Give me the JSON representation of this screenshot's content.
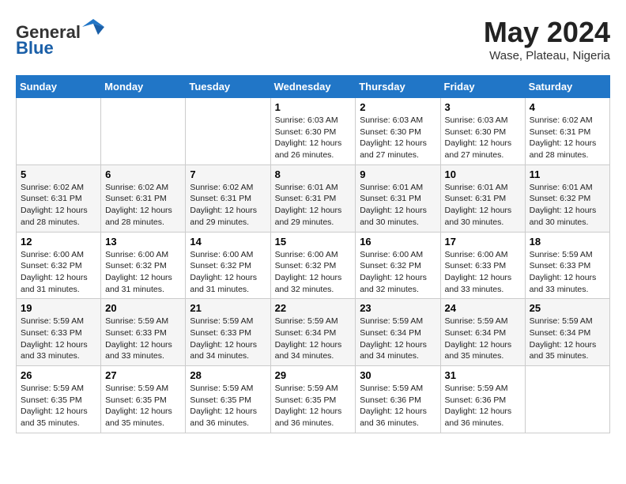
{
  "header": {
    "logo_general": "General",
    "logo_blue": "Blue",
    "month_year": "May 2024",
    "location": "Wase, Plateau, Nigeria"
  },
  "weekdays": [
    "Sunday",
    "Monday",
    "Tuesday",
    "Wednesday",
    "Thursday",
    "Friday",
    "Saturday"
  ],
  "weeks": [
    [
      {
        "day": "",
        "info": ""
      },
      {
        "day": "",
        "info": ""
      },
      {
        "day": "",
        "info": ""
      },
      {
        "day": "1",
        "info": "Sunrise: 6:03 AM\nSunset: 6:30 PM\nDaylight: 12 hours\nand 26 minutes."
      },
      {
        "day": "2",
        "info": "Sunrise: 6:03 AM\nSunset: 6:30 PM\nDaylight: 12 hours\nand 27 minutes."
      },
      {
        "day": "3",
        "info": "Sunrise: 6:03 AM\nSunset: 6:30 PM\nDaylight: 12 hours\nand 27 minutes."
      },
      {
        "day": "4",
        "info": "Sunrise: 6:02 AM\nSunset: 6:31 PM\nDaylight: 12 hours\nand 28 minutes."
      }
    ],
    [
      {
        "day": "5",
        "info": "Sunrise: 6:02 AM\nSunset: 6:31 PM\nDaylight: 12 hours\nand 28 minutes."
      },
      {
        "day": "6",
        "info": "Sunrise: 6:02 AM\nSunset: 6:31 PM\nDaylight: 12 hours\nand 28 minutes."
      },
      {
        "day": "7",
        "info": "Sunrise: 6:02 AM\nSunset: 6:31 PM\nDaylight: 12 hours\nand 29 minutes."
      },
      {
        "day": "8",
        "info": "Sunrise: 6:01 AM\nSunset: 6:31 PM\nDaylight: 12 hours\nand 29 minutes."
      },
      {
        "day": "9",
        "info": "Sunrise: 6:01 AM\nSunset: 6:31 PM\nDaylight: 12 hours\nand 30 minutes."
      },
      {
        "day": "10",
        "info": "Sunrise: 6:01 AM\nSunset: 6:31 PM\nDaylight: 12 hours\nand 30 minutes."
      },
      {
        "day": "11",
        "info": "Sunrise: 6:01 AM\nSunset: 6:32 PM\nDaylight: 12 hours\nand 30 minutes."
      }
    ],
    [
      {
        "day": "12",
        "info": "Sunrise: 6:00 AM\nSunset: 6:32 PM\nDaylight: 12 hours\nand 31 minutes."
      },
      {
        "day": "13",
        "info": "Sunrise: 6:00 AM\nSunset: 6:32 PM\nDaylight: 12 hours\nand 31 minutes."
      },
      {
        "day": "14",
        "info": "Sunrise: 6:00 AM\nSunset: 6:32 PM\nDaylight: 12 hours\nand 31 minutes."
      },
      {
        "day": "15",
        "info": "Sunrise: 6:00 AM\nSunset: 6:32 PM\nDaylight: 12 hours\nand 32 minutes."
      },
      {
        "day": "16",
        "info": "Sunrise: 6:00 AM\nSunset: 6:32 PM\nDaylight: 12 hours\nand 32 minutes."
      },
      {
        "day": "17",
        "info": "Sunrise: 6:00 AM\nSunset: 6:33 PM\nDaylight: 12 hours\nand 33 minutes."
      },
      {
        "day": "18",
        "info": "Sunrise: 5:59 AM\nSunset: 6:33 PM\nDaylight: 12 hours\nand 33 minutes."
      }
    ],
    [
      {
        "day": "19",
        "info": "Sunrise: 5:59 AM\nSunset: 6:33 PM\nDaylight: 12 hours\nand 33 minutes."
      },
      {
        "day": "20",
        "info": "Sunrise: 5:59 AM\nSunset: 6:33 PM\nDaylight: 12 hours\nand 33 minutes."
      },
      {
        "day": "21",
        "info": "Sunrise: 5:59 AM\nSunset: 6:33 PM\nDaylight: 12 hours\nand 34 minutes."
      },
      {
        "day": "22",
        "info": "Sunrise: 5:59 AM\nSunset: 6:34 PM\nDaylight: 12 hours\nand 34 minutes."
      },
      {
        "day": "23",
        "info": "Sunrise: 5:59 AM\nSunset: 6:34 PM\nDaylight: 12 hours\nand 34 minutes."
      },
      {
        "day": "24",
        "info": "Sunrise: 5:59 AM\nSunset: 6:34 PM\nDaylight: 12 hours\nand 35 minutes."
      },
      {
        "day": "25",
        "info": "Sunrise: 5:59 AM\nSunset: 6:34 PM\nDaylight: 12 hours\nand 35 minutes."
      }
    ],
    [
      {
        "day": "26",
        "info": "Sunrise: 5:59 AM\nSunset: 6:35 PM\nDaylight: 12 hours\nand 35 minutes."
      },
      {
        "day": "27",
        "info": "Sunrise: 5:59 AM\nSunset: 6:35 PM\nDaylight: 12 hours\nand 35 minutes."
      },
      {
        "day": "28",
        "info": "Sunrise: 5:59 AM\nSunset: 6:35 PM\nDaylight: 12 hours\nand 36 minutes."
      },
      {
        "day": "29",
        "info": "Sunrise: 5:59 AM\nSunset: 6:35 PM\nDaylight: 12 hours\nand 36 minutes."
      },
      {
        "day": "30",
        "info": "Sunrise: 5:59 AM\nSunset: 6:36 PM\nDaylight: 12 hours\nand 36 minutes."
      },
      {
        "day": "31",
        "info": "Sunrise: 5:59 AM\nSunset: 6:36 PM\nDaylight: 12 hours\nand 36 minutes."
      },
      {
        "day": "",
        "info": ""
      }
    ]
  ]
}
